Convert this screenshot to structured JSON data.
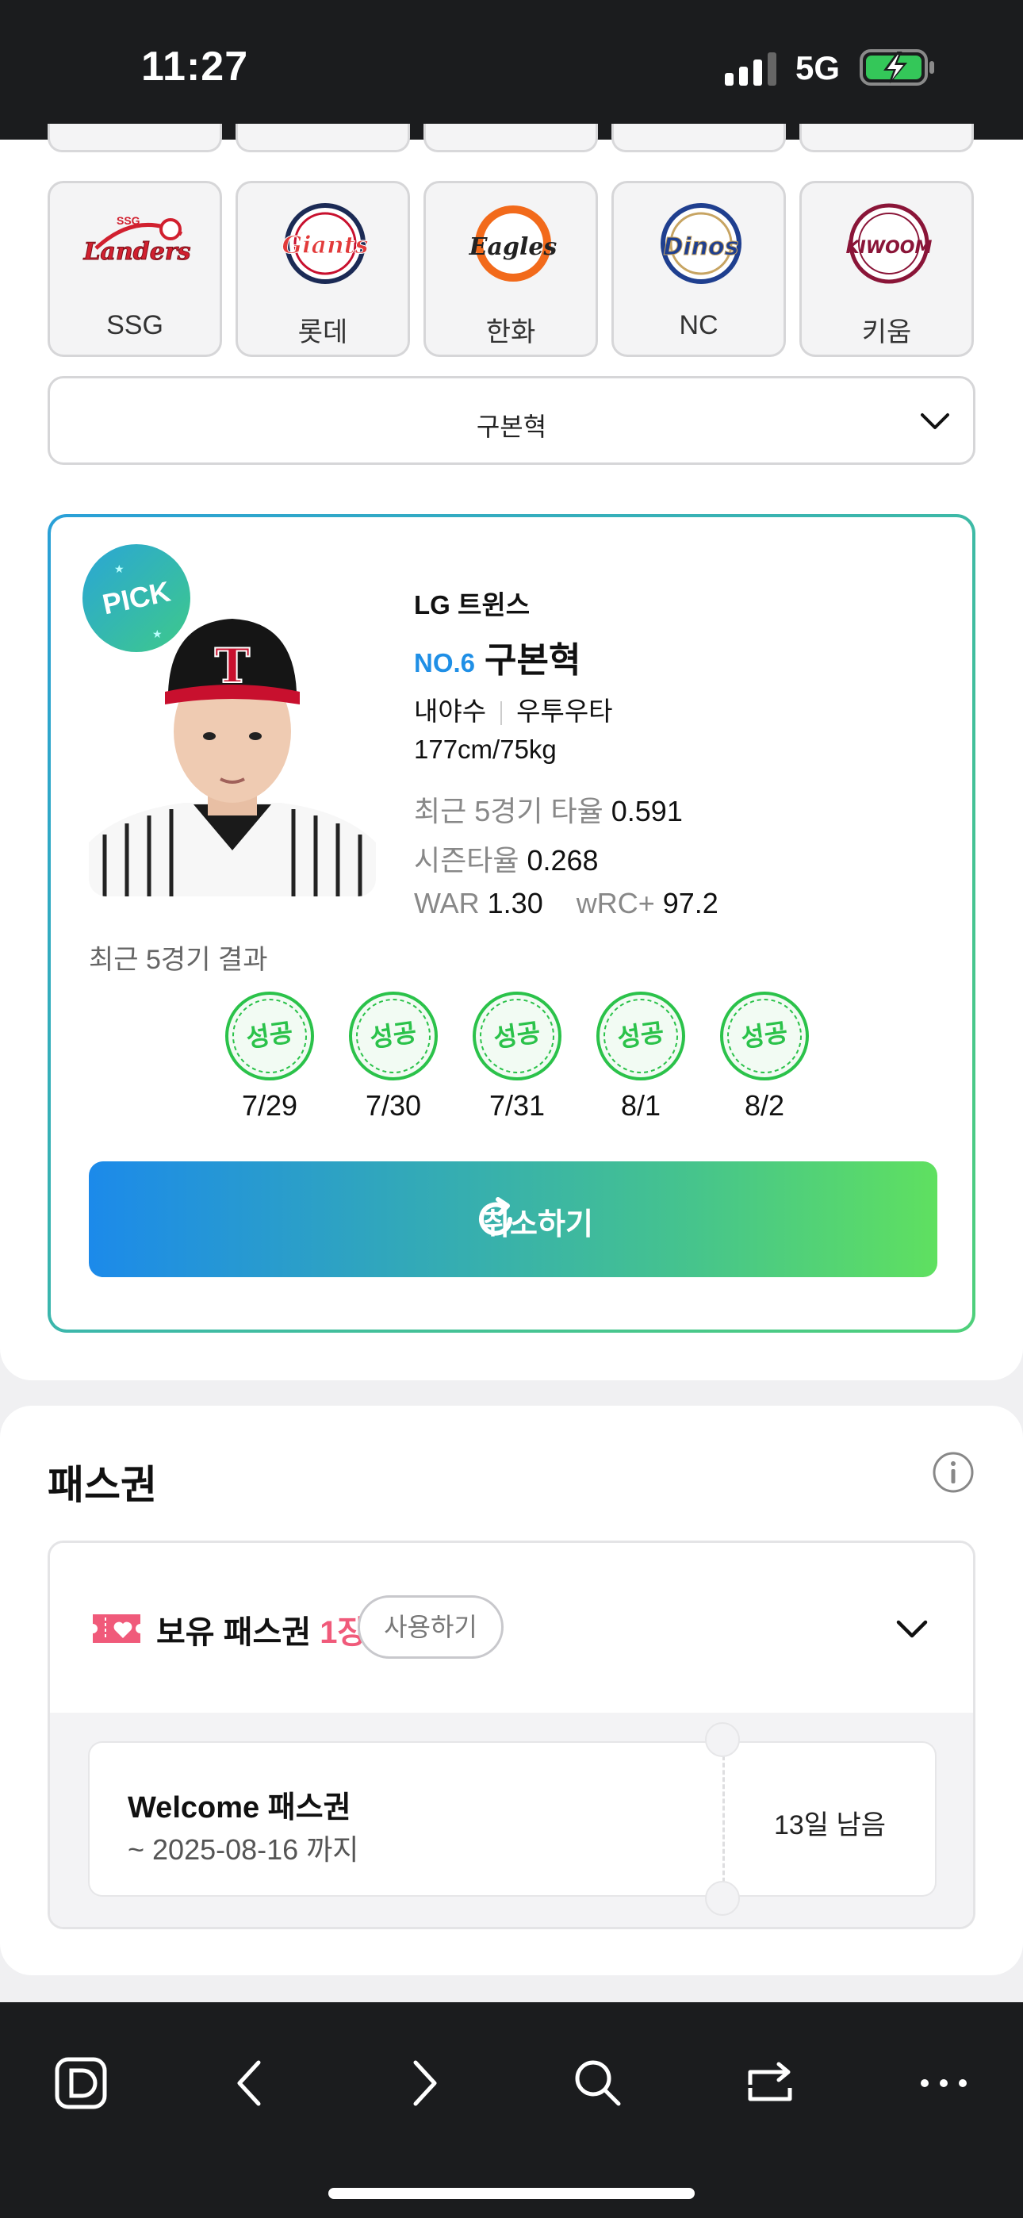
{
  "status_bar": {
    "time": "11:27",
    "network": "5G"
  },
  "teams": [
    {
      "name": "SSG",
      "logo": "landers-logo",
      "logo_text": "Landers",
      "color": "#d1202f"
    },
    {
      "name": "롯데",
      "logo": "giants-logo",
      "logo_text": "Giants",
      "color": "#e23a3a"
    },
    {
      "name": "한화",
      "logo": "eagles-logo",
      "logo_text": "Eagles",
      "color": "#f26a1b"
    },
    {
      "name": "NC",
      "logo": "dinos-logo",
      "logo_text": "Dinos",
      "color": "#1f3f8f"
    },
    {
      "name": "키움",
      "logo": "kiwoom-logo",
      "logo_text": "KIWOOM",
      "color": "#8a1538"
    }
  ],
  "player_select": {
    "value": "구본혁"
  },
  "pick_card": {
    "badge": "PICK",
    "team": "LG 트윈스",
    "number": "NO.6",
    "name": "구본혁",
    "position": "내야수",
    "handedness": "우투우타",
    "body": "177cm/75kg",
    "stats": {
      "recent5_label": "최근 5경기 타율",
      "recent5_value": "0.591",
      "season_label": "시즌타율",
      "season_value": "0.268",
      "war_label": "WAR",
      "war_value": "1.30",
      "wrc_label": "wRC+",
      "wrc_value": "97.2"
    },
    "recent_title": "최근 5경기 결과",
    "results": [
      {
        "result": "성공",
        "date": "7/29"
      },
      {
        "result": "성공",
        "date": "7/30"
      },
      {
        "result": "성공",
        "date": "7/31"
      },
      {
        "result": "성공",
        "date": "8/1"
      },
      {
        "result": "성공",
        "date": "8/2"
      }
    ],
    "cancel_label": "취소하기"
  },
  "pass": {
    "title": "패스권",
    "owned_label": "보유 패스권",
    "owned_count": "1장",
    "use_label": "사용하기",
    "ticket": {
      "name": "Welcome 패스권",
      "until": "~ 2025-08-16 까지",
      "left": "13일 남음"
    }
  },
  "colors": {
    "accent_blue": "#1f8fe6",
    "success_green": "#2bc24a",
    "pass_pink": "#f05a7a"
  }
}
